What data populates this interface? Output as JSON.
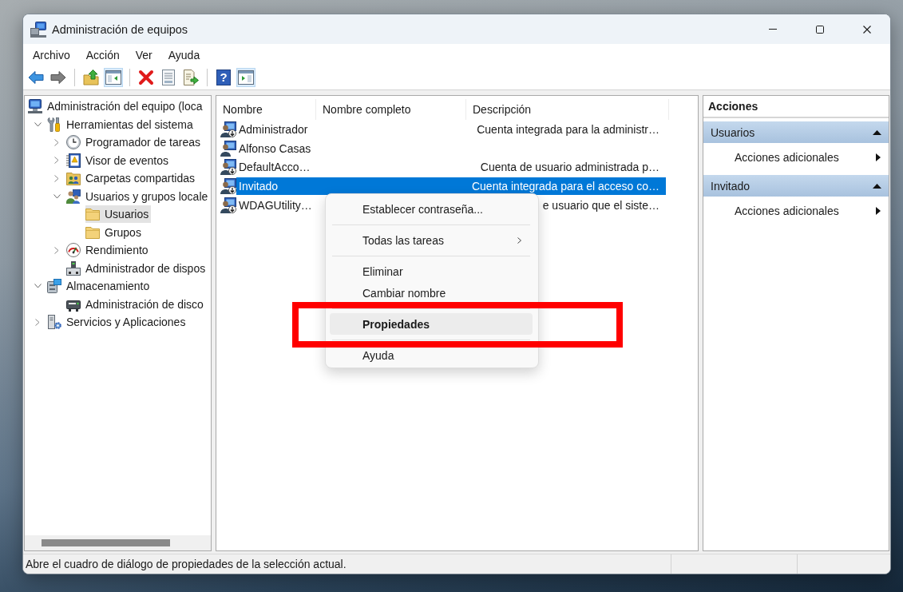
{
  "window": {
    "title": "Administración de equipos"
  },
  "menu_bar": [
    "Archivo",
    "Acción",
    "Ver",
    "Ayuda"
  ],
  "toolbar": [
    {
      "kind": "back",
      "pressed": false,
      "disabled": false
    },
    {
      "kind": "forward",
      "pressed": false,
      "disabled": true
    },
    {
      "kind": "separator"
    },
    {
      "kind": "up",
      "pressed": false,
      "disabled": false
    },
    {
      "kind": "tree",
      "pressed": true,
      "disabled": false
    },
    {
      "kind": "separator"
    },
    {
      "kind": "delete",
      "pressed": false,
      "disabled": false
    },
    {
      "kind": "properties",
      "pressed": false,
      "disabled": false
    },
    {
      "kind": "export",
      "pressed": false,
      "disabled": false
    },
    {
      "kind": "separator"
    },
    {
      "kind": "help",
      "glyph": "?",
      "pressed": false,
      "disabled": false
    },
    {
      "kind": "actionpane",
      "pressed": true,
      "disabled": false
    }
  ],
  "tree": [
    {
      "label": "Administración del equipo (loca",
      "kind": "computer",
      "selected": false,
      "children": [
        {
          "label": "Herramientas del sistema",
          "kind": "tools",
          "expanded": true,
          "selected": false,
          "children": [
            {
              "label": "Programador de tareas",
              "kind": "scheduler",
              "expanded": false,
              "selected": false
            },
            {
              "label": "Visor de eventos",
              "kind": "eventlog",
              "expanded": false,
              "selected": false
            },
            {
              "label": "Carpetas compartidas",
              "kind": "shares",
              "expanded": false,
              "selected": false
            },
            {
              "label": "Usuarios y grupos locale",
              "kind": "usersgroups",
              "expanded": true,
              "selected": false,
              "children": [
                {
                  "label": "Usuarios",
                  "kind": "folder",
                  "selected": true
                },
                {
                  "label": "Grupos",
                  "kind": "folder",
                  "selected": false
                }
              ]
            },
            {
              "label": "Rendimiento",
              "kind": "performance",
              "expanded": false,
              "selected": false
            },
            {
              "label": "Administrador de dispos",
              "kind": "devices",
              "selected": false
            }
          ]
        },
        {
          "label": "Almacenamiento",
          "kind": "storage",
          "expanded": true,
          "selected": false,
          "children": [
            {
              "label": "Administración de disco",
              "kind": "disks",
              "selected": false
            }
          ]
        },
        {
          "label": "Servicios y Aplicaciones",
          "kind": "services",
          "expanded": false,
          "selected": false
        }
      ]
    }
  ],
  "list": {
    "columns": [
      "Nombre",
      "Nombre completo",
      "Descripción"
    ],
    "rows": [
      {
        "name": "Administrador",
        "description": "Cuenta integrada para la administr…",
        "disabled": true,
        "selected": false
      },
      {
        "name": "Alfonso Casas",
        "disabled": false,
        "selected": false
      },
      {
        "name": "DefaultAcco…",
        "description": "Cuenta de usuario administrada p…",
        "disabled": true,
        "selected": false
      },
      {
        "name": "Invitado",
        "description": "Cuenta integrada para el acceso co…",
        "disabled": true,
        "selected": true
      },
      {
        "name": "WDAGUtility…",
        "description": "e usuario que el siste…",
        "disabled": true,
        "selected": false
      }
    ]
  },
  "context_menu": {
    "highlight_frame": true,
    "items": [
      {
        "kind": "item",
        "label": "Establecer contraseña...",
        "submenu": false,
        "default": false,
        "selected": false
      },
      {
        "kind": "separator"
      },
      {
        "kind": "item",
        "label": "Todas las tareas",
        "submenu": true,
        "default": false,
        "selected": false
      },
      {
        "kind": "separator"
      },
      {
        "kind": "item",
        "label": "Eliminar",
        "submenu": false,
        "default": false,
        "selected": false
      },
      {
        "kind": "item",
        "label": "Cambiar nombre",
        "submenu": false,
        "default": false,
        "selected": false
      },
      {
        "kind": "separator"
      },
      {
        "kind": "item",
        "label": "Propiedades",
        "submenu": false,
        "default": true,
        "selected": true
      },
      {
        "kind": "separator"
      },
      {
        "kind": "item",
        "label": "Ayuda",
        "submenu": false,
        "default": false,
        "selected": false
      }
    ]
  },
  "actions": {
    "title": "Acciones",
    "sections": [
      {
        "title": "Usuarios",
        "expanded": true,
        "items": [
          {
            "label": "Acciones adicionales",
            "submenu": true
          }
        ]
      },
      {
        "title": "Invitado",
        "expanded": true,
        "items": [
          {
            "label": "Acciones adicionales",
            "submenu": true
          }
        ]
      }
    ]
  },
  "status_bar": {
    "text": "Abre el cuadro de diálogo de propiedades de la selección actual."
  }
}
